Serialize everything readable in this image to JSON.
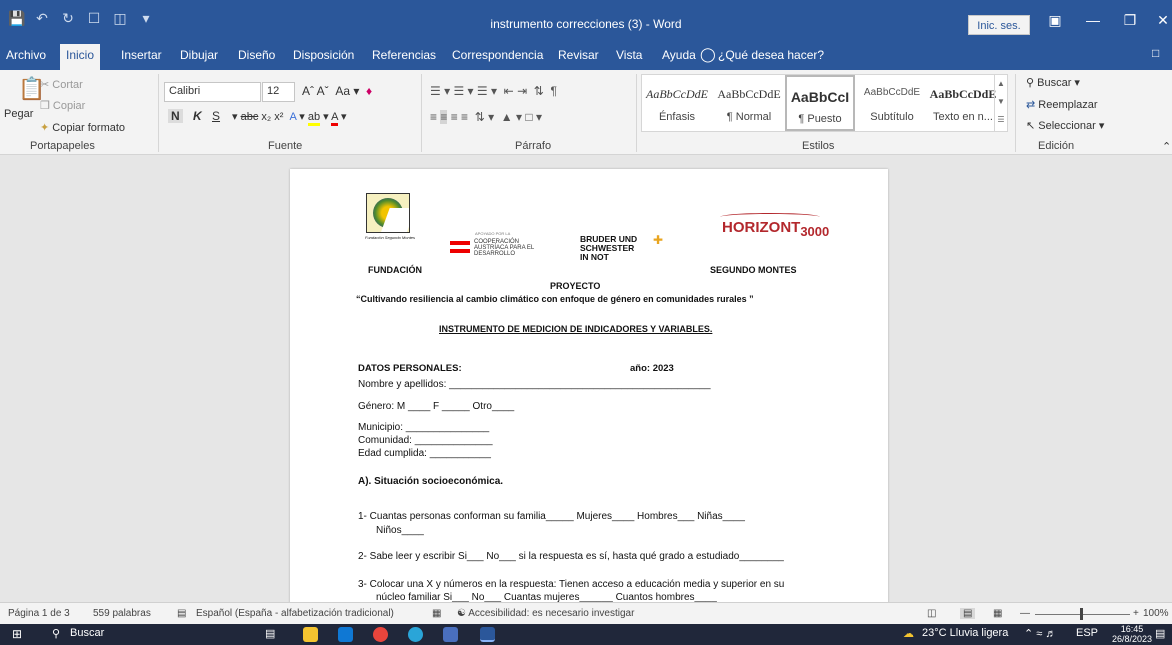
{
  "window": {
    "title": "instrumento correcciones (3)  -  Word",
    "signin": "Inic. ses."
  },
  "tabs": [
    "Archivo",
    "Inicio",
    "Insertar",
    "Dibujar",
    "Diseño",
    "Disposición",
    "Referencias",
    "Correspondencia",
    "Revisar",
    "Vista",
    "Ayuda"
  ],
  "tell_me": "¿Qué desea hacer?",
  "ribbon": {
    "clipboard": {
      "paste": "Pegar",
      "cut": "Cortar",
      "copy": "Copiar",
      "format_painter": "Copiar formato",
      "group": "Portapapeles"
    },
    "font": {
      "name": "Calibri",
      "size": "12",
      "group": "Fuente",
      "bold": "N",
      "italic": "K",
      "underline": "S"
    },
    "paragraph": {
      "group": "Párrafo"
    },
    "styles": {
      "group": "Estilos",
      "items": [
        {
          "preview": "AaBbCcDdE",
          "name": "Énfasis"
        },
        {
          "preview": "AaBbCcDdE",
          "name": "¶ Normal"
        },
        {
          "preview": "AaBbCcI",
          "name": "¶ Puesto"
        },
        {
          "preview": "AaBbCcDdE",
          "name": "Subtítulo"
        },
        {
          "preview": "AaBbCcDdE",
          "name": "Texto en n..."
        }
      ]
    },
    "editing": {
      "find": "Buscar",
      "replace": "Reemplazar",
      "select": "Seleccionar",
      "group": "Edición"
    }
  },
  "document": {
    "logo_left_caption": "Fundación Segundo Montes",
    "coop_small": "APOYADO POR LA",
    "coop_lines": [
      "COOPERACIÓN",
      "AUSTRÍACA PARA EL",
      "DESARROLLO"
    ],
    "bruder_lines": [
      "BRUDER UND",
      "SCHWESTER",
      "IN NOT"
    ],
    "horizont_main": "HORIZONT",
    "horizont_sub": "3000",
    "fundacion": "FUNDACIÓN",
    "segundo": "SEGUNDO MONTES",
    "proyecto": "PROYECTO",
    "project_title": "“Cultivando resiliencia al cambio climático con enfoque de género en comunidades rurales ”",
    "instrument_title": "INSTRUMENTO DE MEDICION DE INDICADORES Y VARIABLES.",
    "datos": "DATOS PERSONALES:",
    "anio": "año: 2023",
    "nombre": "Nombre y apellidos: _______________________________________________",
    "genero": "Género: M ____ F _____ Otro____",
    "municipio": "Municipio: _______________",
    "comunidad": "Comunidad: ______________",
    "edad": "Edad cumplida: ___________",
    "section_a": "A). Situación socioeconómica.",
    "q1a": "1-  Cuantas personas conforman su familia_____ Mujeres____ Hombres___ Niñas____",
    "q1b": "Niños____",
    "q2": "2-  Sabe leer y escribir Si___ No___ si la respuesta es sí, hasta qué grado a estudiado________",
    "q3a": "3-  Colocar una X y números en la respuesta: Tienen acceso a educación media y superior en su",
    "q3b": "núcleo familiar Si___ No___ Cuantas mujeres______ Cuantos hombres____"
  },
  "status": {
    "page": "Página 1 de 3",
    "words": "559 palabras",
    "language": "Español (España - alfabetización tradicional)",
    "accessibility": "Accesibilidad: es necesario investigar",
    "zoom": "100%"
  },
  "taskbar": {
    "search": "Buscar",
    "weather": "23°C  Lluvia ligera",
    "lang": "ESP",
    "time": "16:45",
    "date": "26/8/2023"
  },
  "colors": {
    "accent": "#2b579a"
  }
}
